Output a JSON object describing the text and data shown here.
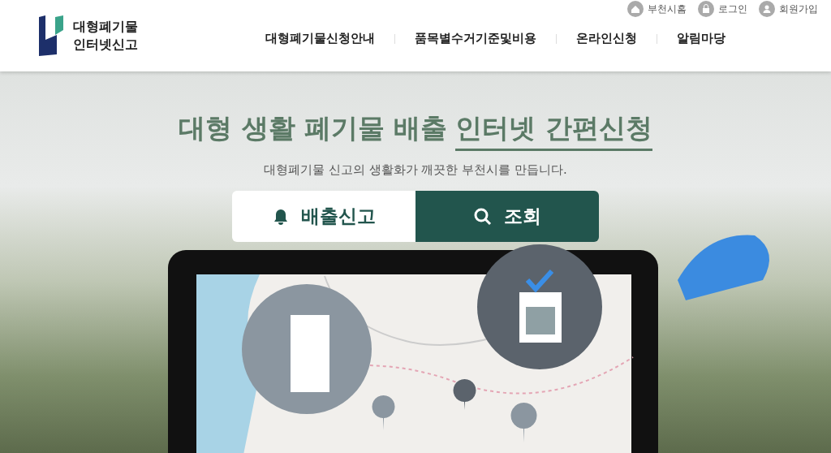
{
  "header": {
    "logo_text": [
      "대형폐기물",
      "인터넷신고"
    ],
    "utility_links": [
      {
        "kind": "home",
        "label": "부천시홈"
      },
      {
        "kind": "login",
        "label": "로그인"
      },
      {
        "kind": "join",
        "label": "회원가입"
      }
    ],
    "nav": [
      "대형폐기물신청안내",
      "품목별수거기준및비용",
      "온라인신청",
      "알림마당"
    ]
  },
  "hero": {
    "title_plain": "대형 생활 폐기물 배출",
    "title_underlined": "인터넷 간편신청",
    "subtitle": "대형폐기물 신고의 생활화가 깨끗한 부천시를 만듭니다.",
    "buttons": [
      {
        "kind": "report",
        "label": "배출신고"
      },
      {
        "kind": "search",
        "label": "조회"
      }
    ]
  }
}
